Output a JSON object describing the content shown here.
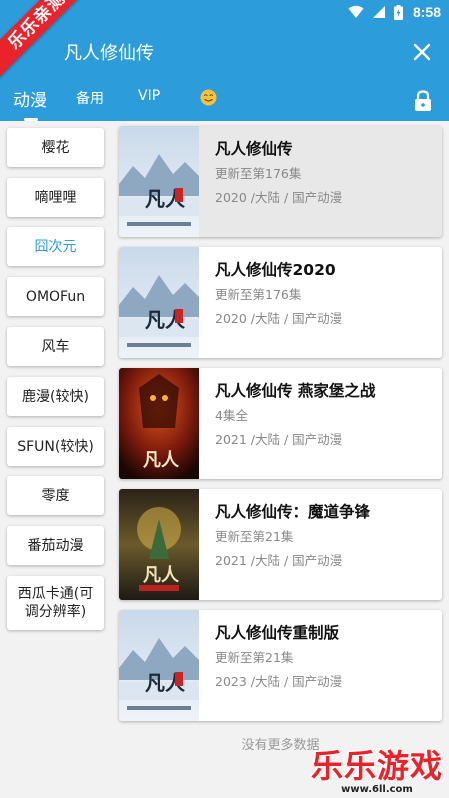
{
  "status_bar": {
    "time": "8:58"
  },
  "ribbon": {
    "text": "乐乐亲测"
  },
  "search": {
    "value": "凡人修仙传"
  },
  "tabs": [
    {
      "label": "动漫",
      "active": true
    },
    {
      "label": "备用"
    },
    {
      "label": "VIP"
    },
    {
      "label": "😊",
      "icon": "smiley-emoji"
    }
  ],
  "sidebar": {
    "items": [
      {
        "label": "樱花"
      },
      {
        "label": "嘀哩哩"
      },
      {
        "label": "囧次元",
        "active": true
      },
      {
        "label": "OMOFun"
      },
      {
        "label": "风车"
      },
      {
        "label": "鹿漫(较快)"
      },
      {
        "label": "SFUN(较快)"
      },
      {
        "label": "零度"
      },
      {
        "label": "番茄动漫"
      },
      {
        "label": "西瓜卡通(可调分辨率)"
      }
    ]
  },
  "results": [
    {
      "title": "凡人修仙传",
      "episodes": "更新至第176集",
      "meta": "2020 /大陆 / 国产动漫",
      "poster": "blue"
    },
    {
      "title": "凡人修仙传2020",
      "episodes": "更新至第176集",
      "meta": "2020 /大陆 / 国产动漫",
      "poster": "blue"
    },
    {
      "title": "凡人修仙传 燕家堡之战",
      "episodes": "4集全",
      "meta": "2021 /大陆 / 国产动漫",
      "poster": "red"
    },
    {
      "title": "凡人修仙传：魔道争锋",
      "episodes": "更新至第21集",
      "meta": "2021 /大陆 / 国产动漫",
      "poster": "gold"
    },
    {
      "title": "凡人修仙传重制版",
      "episodes": "更新至第21集",
      "meta": "2023 /大陆 / 国产动漫",
      "poster": "blue"
    }
  ],
  "footer": {
    "no_more": "没有更多数据"
  },
  "watermark": {
    "brand": "乐乐游戏",
    "url": "www.6ll.com"
  },
  "colors": {
    "accent": "#2d9cdb",
    "ribbon": "#e8232b"
  }
}
